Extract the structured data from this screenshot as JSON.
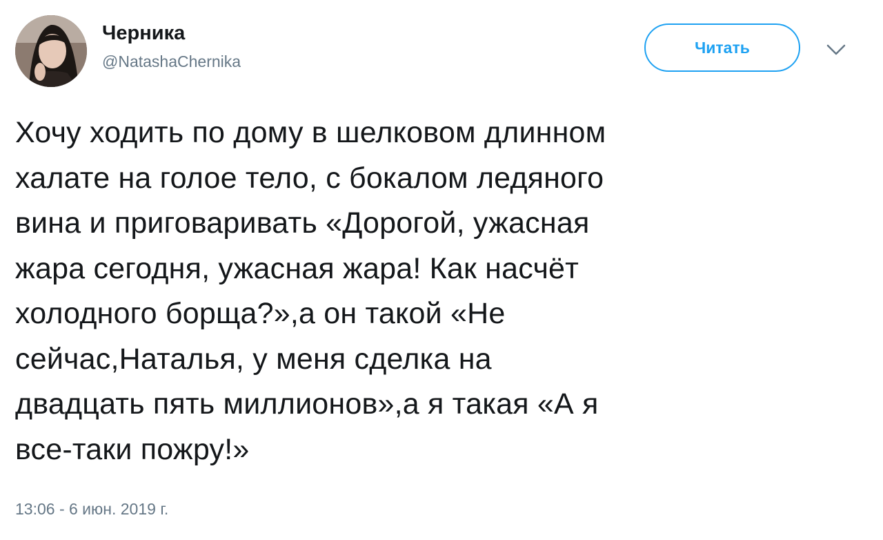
{
  "author": {
    "display_name": "Черника",
    "handle": "@NatashaChernika"
  },
  "follow_button": {
    "label": "Читать"
  },
  "tweet": {
    "lines": [
      "Хочу ходить по дому в шелковом длинном",
      "халате на голое тело, с бокалом ледяного",
      "вина и приговаривать «Дорогой, ужасная",
      "жара сегодня, ужасная жара! Как насчёт",
      "холодного борща?»,а он такой «Не",
      "сейчас,Наталья, у меня сделка на",
      "двадцать пять миллионов»,а я такая «А я",
      "все-таки пожру!»"
    ],
    "timestamp": "13:06 - 6 июн. 2019 г."
  },
  "icons": {
    "menu": "chevron-down-icon",
    "avatar": "avatar"
  },
  "colors": {
    "accent": "#1da1f2",
    "text": "#14171a",
    "secondary_text": "#657786"
  }
}
